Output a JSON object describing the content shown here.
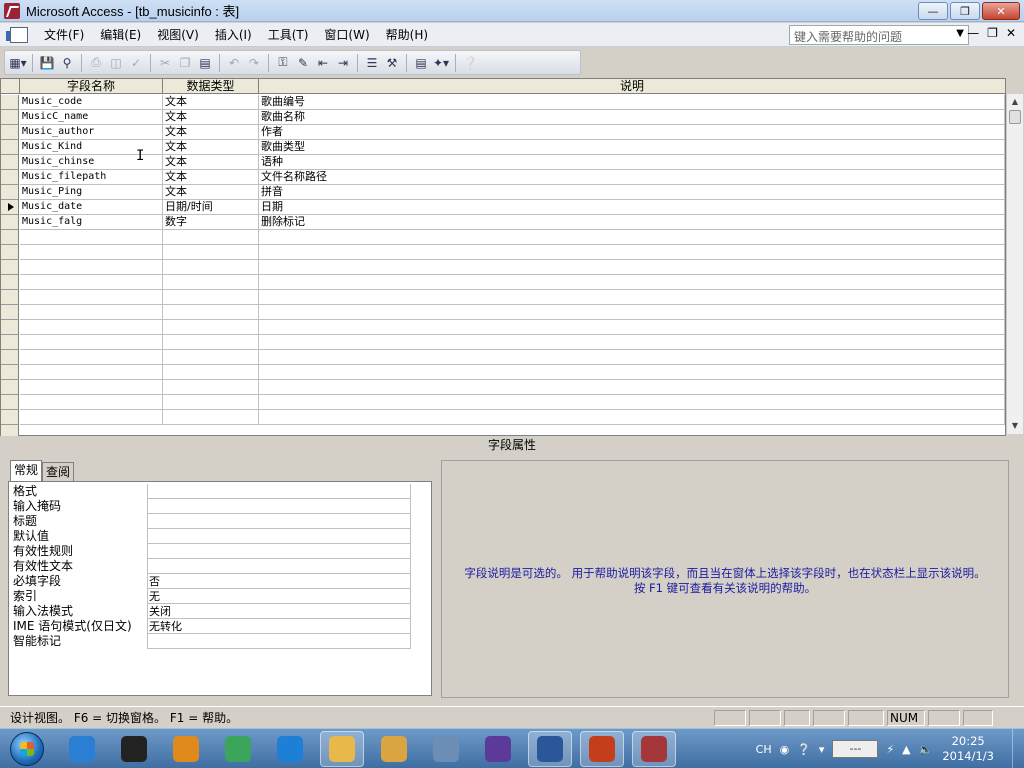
{
  "window": {
    "title": "Microsoft Access - [tb_musicinfo : 表]"
  },
  "menu": {
    "items": [
      "文件(F)",
      "编辑(E)",
      "视图(V)",
      "插入(I)",
      "工具(T)",
      "窗口(W)",
      "帮助(H)"
    ],
    "help_placeholder": "键入需要帮助的问题"
  },
  "toolbar": {
    "icons": [
      "table-view-icon",
      "save-icon",
      "search-icon",
      "print-icon",
      "print-preview-icon",
      "spelling-icon",
      "cut-icon",
      "copy-icon",
      "paste-icon",
      "undo-icon",
      "redo-icon",
      "primary-key-icon",
      "builder-icon",
      "insert-rows-icon",
      "delete-rows-icon",
      "properties-icon",
      "build-icon",
      "database-window-icon",
      "new-object-icon",
      "help-icon"
    ]
  },
  "grid": {
    "headers": [
      "字段名称",
      "数据类型",
      "说明"
    ],
    "rows": [
      {
        "name": "Music_code",
        "type": "文本",
        "desc": "歌曲编号"
      },
      {
        "name": "MusicC_name",
        "type": "文本",
        "desc": "歌曲名称"
      },
      {
        "name": "Music_author",
        "type": "文本",
        "desc": "作者"
      },
      {
        "name": "Music_Kind",
        "type": "文本",
        "desc": "歌曲类型"
      },
      {
        "name": "Music_chinse",
        "type": "文本",
        "desc": "语种"
      },
      {
        "name": "Music_filepath",
        "type": "文本",
        "desc": "文件名称路径"
      },
      {
        "name": "Music_Ping",
        "type": "文本",
        "desc": "拼音"
      },
      {
        "name": "Music_date",
        "type": "日期/时间",
        "desc": "日期"
      },
      {
        "name": "Music_falg",
        "type": "数字",
        "desc": "删除标记"
      }
    ],
    "current_row": 7,
    "total_rows": 22
  },
  "field_properties": {
    "caption": "字段属性",
    "tabs": [
      "常规",
      "查阅"
    ],
    "active_tab": 0,
    "props": [
      {
        "label": "格式",
        "value": ""
      },
      {
        "label": "输入掩码",
        "value": ""
      },
      {
        "label": "标题",
        "value": ""
      },
      {
        "label": "默认值",
        "value": ""
      },
      {
        "label": "有效性规则",
        "value": ""
      },
      {
        "label": "有效性文本",
        "value": ""
      },
      {
        "label": "必填字段",
        "value": "否"
      },
      {
        "label": "索引",
        "value": "无"
      },
      {
        "label": "输入法模式",
        "value": "关闭"
      },
      {
        "label": "IME 语句模式(仅日文)",
        "value": "无转化"
      },
      {
        "label": "智能标记",
        "value": ""
      }
    ],
    "help_line1": "字段说明是可选的。 用于帮助说明该字段，而且当在窗体上选择该字段时，也在状态栏上显示该说明。",
    "help_line2": "按 F1 键可查看有关该说明的帮助。"
  },
  "status": {
    "text": "设计视图。 F6 = 切换窗格。 F1 = 帮助。",
    "num": "NUM"
  },
  "taskbar": {
    "apps": [
      {
        "name": "feiq-icon",
        "color": "#2a7fd4"
      },
      {
        "name": "qq-icon",
        "color": "#222222"
      },
      {
        "name": "gift-icon",
        "color": "#e08a1e"
      },
      {
        "name": "chrome-icon",
        "color": "#3ba55c"
      },
      {
        "name": "ie-icon",
        "color": "#1e7fd6"
      },
      {
        "name": "explorer-icon",
        "color": "#e8b84a"
      },
      {
        "name": "tools-icon",
        "color": "#d9a441"
      },
      {
        "name": "network-icon",
        "color": "#6c8db5"
      },
      {
        "name": "vs-icon",
        "color": "#5b3a9a"
      },
      {
        "name": "word-icon",
        "color": "#2b579a"
      },
      {
        "name": "powerpoint-icon",
        "color": "#c43e1c"
      },
      {
        "name": "access-icon",
        "color": "#a4373a"
      }
    ],
    "ime": "CH",
    "ime_box": "---",
    "time": "20:25",
    "date": "2014/1/3"
  }
}
